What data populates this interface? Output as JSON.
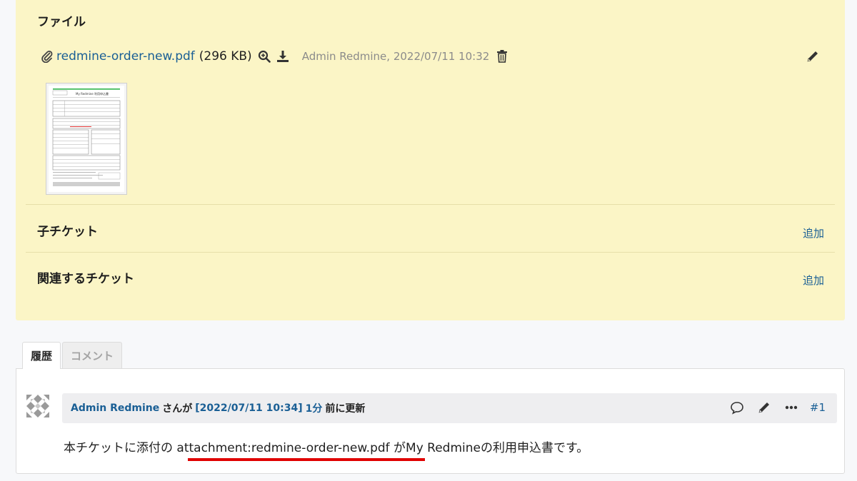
{
  "files": {
    "title": "ファイル",
    "attachment": {
      "filename": "redmine-order-new.pdf",
      "size": "(296 KB)",
      "author_date": "Admin Redmine, 2022/07/11 10:32"
    },
    "thumbnail": {
      "doc_title": "My Redmine 利用申込書"
    }
  },
  "subtasks": {
    "title": "子チケット",
    "add_label": "追加"
  },
  "relations": {
    "title": "関連するチケット",
    "add_label": "追加"
  },
  "tabs": [
    {
      "label": "履歴",
      "active": true
    },
    {
      "label": "コメント",
      "active": false
    }
  ],
  "journal": {
    "author": "Admin Redmine",
    "by_text": "さんが",
    "timestamp": "[2022/07/11 10:34]",
    "ago": "1分",
    "updated_text": "前に更新",
    "number": "#1",
    "note_prefix": "本チケットに添付の",
    "note_link": "attachment:redmine-order-new.pdf",
    "note_suffix": "がMy Redmineの利用申込書です。"
  },
  "colors": {
    "issue_bg": "#fbf5c6",
    "link": "#1a5f95",
    "highlight_underline": "#e00000"
  }
}
